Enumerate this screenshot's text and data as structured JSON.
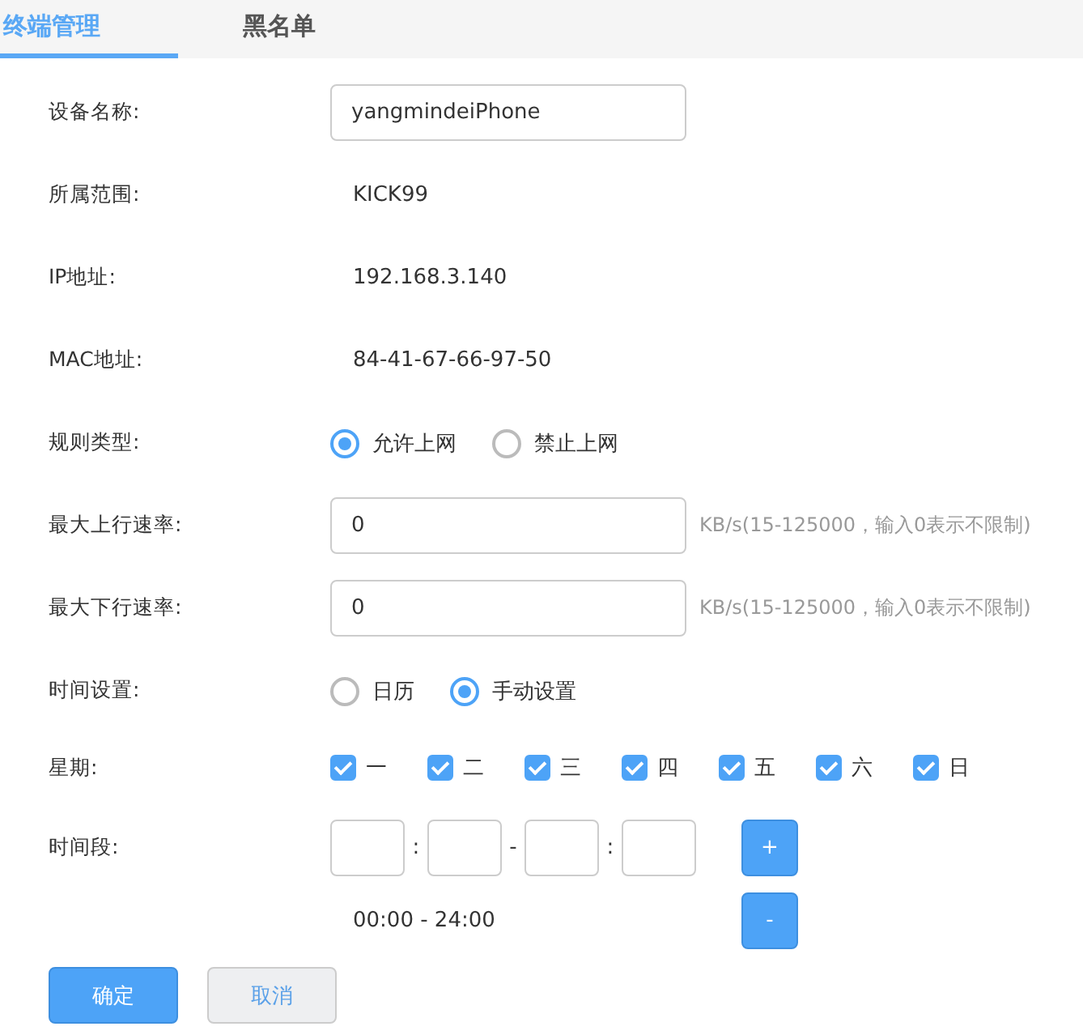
{
  "tabs": [
    {
      "label": "终端管理",
      "selected": true
    },
    {
      "label": "黑名单",
      "selected": false
    }
  ],
  "fields": [
    {
      "kind": "input",
      "label": "设备名称:",
      "value": "yangmindeiPhone"
    },
    {
      "kind": "text",
      "label": "所属范围:",
      "value": "KICK99"
    },
    {
      "kind": "text",
      "label": "IP地址:",
      "value": "192.168.3.140"
    },
    {
      "kind": "text",
      "label": "MAC地址:",
      "value": "84-41-67-66-97-50"
    },
    {
      "kind": "radio",
      "label": "规则类型:",
      "options": [
        {
          "label": "允许上网",
          "selected": true
        },
        {
          "label": "禁止上网",
          "selected": false
        }
      ]
    },
    {
      "kind": "rate",
      "label": "最大上行速率:",
      "value": "0",
      "hint": "KB/s(15-125000，输入0表示不限制)"
    },
    {
      "kind": "rate",
      "label": "最大下行速率:",
      "value": "0",
      "hint": "KB/s(15-125000，输入0表示不限制)"
    },
    {
      "kind": "radio",
      "label": "时间设置:",
      "options": [
        {
          "label": "日历",
          "selected": false
        },
        {
          "label": "手动设置",
          "selected": true
        }
      ]
    },
    {
      "kind": "checks",
      "label": "星期:",
      "options": [
        {
          "label": "一",
          "checked": true
        },
        {
          "label": "二",
          "checked": true
        },
        {
          "label": "三",
          "checked": true
        },
        {
          "label": "四",
          "checked": true
        },
        {
          "label": "五",
          "checked": true
        },
        {
          "label": "六",
          "checked": true
        },
        {
          "label": "日",
          "checked": true
        }
      ]
    },
    {
      "kind": "timerange",
      "label": "时间段:",
      "separators": [
        ":",
        "-",
        ":"
      ],
      "add": "+",
      "remove": "-",
      "range": "00:00 - 24:00"
    }
  ],
  "buttons": [
    {
      "label": "确定",
      "kind": "primary"
    },
    {
      "label": "取消",
      "kind": "secondary"
    }
  ]
}
